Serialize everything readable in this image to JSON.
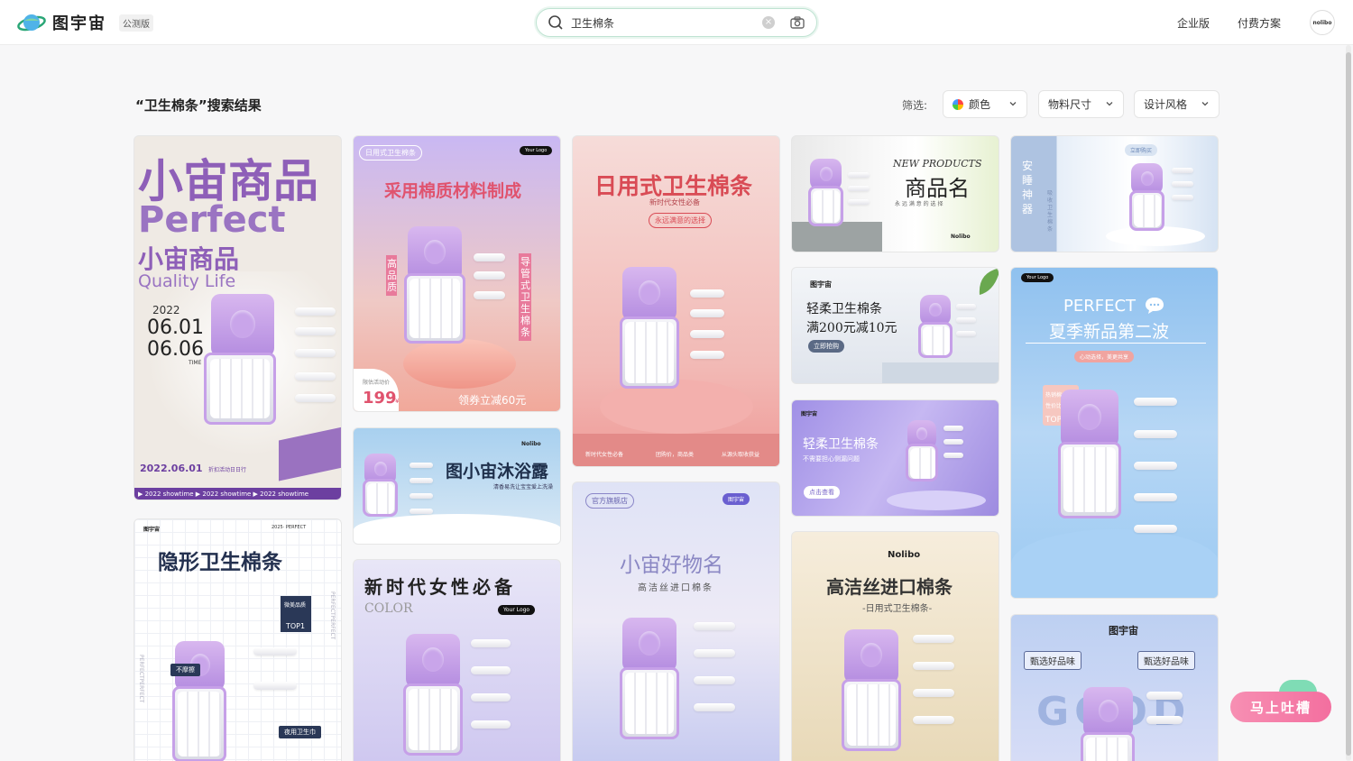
{
  "brand": {
    "name": "图宇宙",
    "badge": "公测版"
  },
  "search": {
    "value": "卫生棉条",
    "clear": "×"
  },
  "nav": {
    "enterprise": "企业版",
    "pricing": "付费方案",
    "avatar": "nolibo"
  },
  "results": {
    "title": "“卫生棉条”搜索结果",
    "filter_label": "筛选:",
    "filters": [
      "颜色",
      "物料尺寸",
      "设计风格"
    ]
  },
  "cards": {
    "c1": {
      "t1": "小宙商品",
      "t2": "Perfect",
      "t3": "小宙商品",
      "t4": "Quality Life",
      "year": "2022",
      "d1": "06.01",
      "d2": "06.06",
      "time": "TIME",
      "date": "2022.06.01",
      "date_note": "折扣活动日日行",
      "showtime": "▶ 2022 showtime  ▶ 2022 showtime  ▶ 2022 showtime"
    },
    "c2": {
      "tag": "日用式卫生棉条",
      "logo": "Your Logo",
      "title": "采用棉质材料制成",
      "left": "高品质",
      "right": "导管式卫生棉条",
      "price_label": "限估活动价",
      "price": "199",
      "unit": "¥",
      "coupon": "领券立减60元"
    },
    "c3": {
      "title": "日用式卫生棉条",
      "sub": "新时代女性必备",
      "pill": "永远满意的选择",
      "b1": "新时代女性必备",
      "b2": "团购价，商品类",
      "b3": "从源头取收获益"
    },
    "c4": {
      "en": "NEW PRODUCTS",
      "title": "商品名",
      "sub": "永 远 满 意 的 选 择",
      "logo": "Nolibo"
    },
    "c5": {
      "pill": "立即购买",
      "vert": "安睡神器",
      "small": "吸收卫生棉条"
    },
    "c6": {
      "brand": "图宇宙",
      "t1": "轻柔卫生棉条",
      "t2": "满200元减10元",
      "pill": "立即抢购"
    },
    "c7": {
      "logo": "Your Logo",
      "en": "PERFECT",
      "title": "夏季新品第二波",
      "pill": "心动选择，美更共享",
      "badge1": "热销棉条",
      "badge2": "性价比",
      "top": "TOP1"
    },
    "c8": {
      "logo": "Nolibo",
      "title": "图小宙沐浴露",
      "sub": "清香易洗让宝宝爱上洗澡"
    },
    "c9": {
      "brand": "图宇宙",
      "title": "轻柔卫生棉条",
      "sub": "不需要担心侧漏问题",
      "pill": "点击查看"
    },
    "c10": {
      "brand": "图宇宙",
      "tag": "2025· PERFECT",
      "title": "隐形卫生棉条",
      "badge": "微美品质",
      "top": "TOP1",
      "l1": "不摩擦",
      "l2": "夜用卫生巾",
      "side": "PERFECTPERFECT"
    },
    "c11": {
      "title": "新时代女性必备",
      "en": "COLOR",
      "logo": "Your Logo"
    },
    "c12": {
      "tag": "官方旗舰店",
      "brand": "图宇宙",
      "title": "小宙好物名",
      "sub": "高洁丝进口棉条"
    },
    "c13": {
      "logo": "Nolibo",
      "title": "高洁丝进口棉条",
      "sub": "-日用式卫生棉条-"
    },
    "c14": {
      "brand": "图宇宙",
      "p1": "甄选好品味",
      "p2": "甄选好品味",
      "big": "GOOD"
    }
  },
  "feedback": {
    "label": "马上吐槽"
  }
}
